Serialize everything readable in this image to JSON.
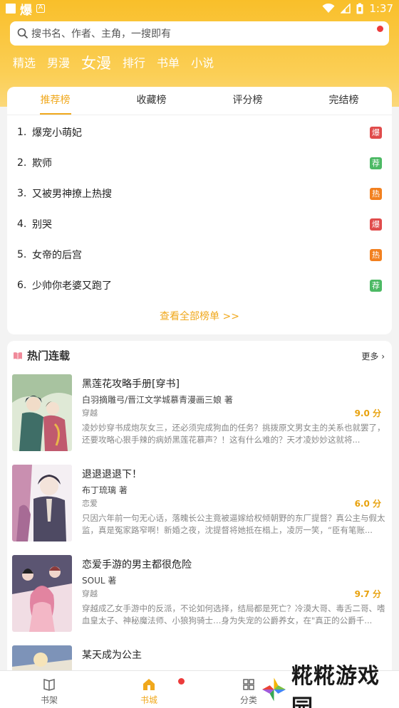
{
  "status_bar": {
    "app_name": "爆",
    "a_label": "A",
    "time": "1:37"
  },
  "search": {
    "placeholder": "搜书名、作者、主角，一搜即有"
  },
  "categories": [
    {
      "label": "精选"
    },
    {
      "label": "男漫"
    },
    {
      "label": "女漫",
      "active": true
    },
    {
      "label": "排行"
    },
    {
      "label": "书单"
    },
    {
      "label": "小说"
    }
  ],
  "rank": {
    "tabs": [
      {
        "label": "推荐榜",
        "active": true
      },
      {
        "label": "收藏榜"
      },
      {
        "label": "评分榜"
      },
      {
        "label": "完结榜"
      }
    ],
    "items": [
      {
        "num": "1.",
        "title": "爆宠小萌妃",
        "badge": "爆",
        "badge_color": "#e04b4b"
      },
      {
        "num": "2.",
        "title": "欺师",
        "badge": "荐",
        "badge_color": "#4cb964"
      },
      {
        "num": "3.",
        "title": "又被男神撩上热搜",
        "badge": "热",
        "badge_color": "#f2801f"
      },
      {
        "num": "4.",
        "title": "别哭",
        "badge": "爆",
        "badge_color": "#e04b4b"
      },
      {
        "num": "5.",
        "title": "女帝的后宫",
        "badge": "热",
        "badge_color": "#f2801f"
      },
      {
        "num": "6.",
        "title": "少帅你老婆又跑了",
        "badge": "荐",
        "badge_color": "#4cb964"
      }
    ],
    "view_all": "查看全部榜单 >>"
  },
  "hot": {
    "title": "热门连载",
    "more": "更多",
    "books": [
      {
        "title": "黑莲花攻略手册[穿书]",
        "author": "白羽摘雕弓/晋江文学城慕青漫画三娘 著",
        "tag": "穿越",
        "score": "9.0 分",
        "desc": "凌妙妙穿书成炮灰女三，还必须完成狗血的任务？挑拨原文男女主的关系也就罢了，还要攻略心狠手辣的病娇黑莲花慕声？！这有什么难的？天才凌妙妙这就将..."
      },
      {
        "title": "退退退退下！",
        "author": "布丁琉璃 著",
        "tag": "恋爱",
        "score": "6.0 分",
        "desc": "只因六年前一句无心话，落魄长公主竟被逼嫁给权倾朝野的东厂提督？真公主与假太监，真是冤家路窄啊！新婚之夜，沈提督将她抵在榻上，凌厉一笑，“臣有笔账..."
      },
      {
        "title": "恋爱手游的男主都很危险",
        "author": "SOUL 著",
        "tag": "穿越",
        "score": "9.7 分",
        "desc": "穿越成乙女手游中的反派，不论如何选择，结局都是死亡？冷漠大哥、毒舌二哥、嗜血皇太子、神秘魔法师、小狼狗骑士…身为失宠的公爵养女，在\"真正的公爵千..."
      },
      {
        "title": "某天成为公主",
        "author": "",
        "tag": "",
        "score": "",
        "desc": ""
      }
    ]
  },
  "bottom_nav": [
    {
      "label": "书架",
      "icon": "bookshelf-icon"
    },
    {
      "label": "书城",
      "icon": "store-icon",
      "active": true
    },
    {
      "label": "分类",
      "icon": "grid-icon"
    }
  ],
  "watermark": {
    "text": "糀糀游戏园"
  },
  "colors": {
    "accent": "#f0a81c",
    "header": "#f9bf2a",
    "hot": "#e04b4b",
    "rec": "#4cb964",
    "fire": "#f2801f"
  }
}
